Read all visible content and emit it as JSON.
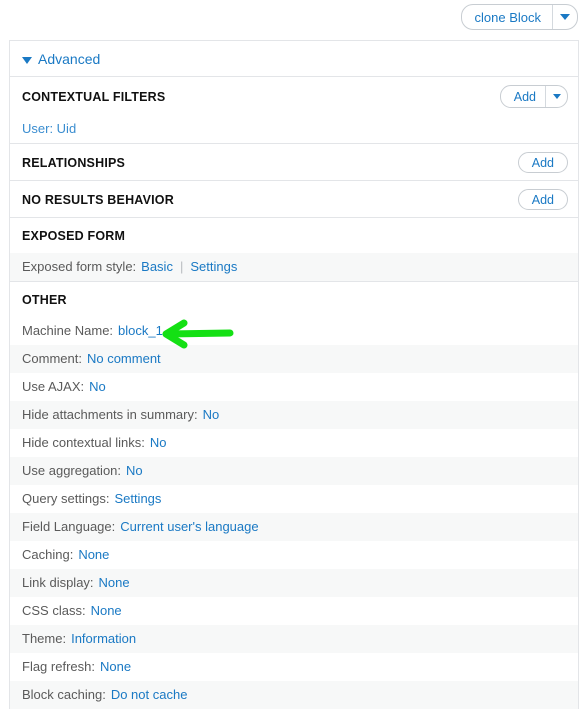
{
  "topbar": {
    "clone_button_label": "clone Block",
    "clone_button_toggle_icon": "caret-down-icon"
  },
  "advanced_panel": {
    "collapse_toggle_icon": "triangle-down-icon",
    "title": "Advanced",
    "sections": [
      {
        "title": "CONTEXTUAL FILTERS",
        "add_label": "Add",
        "has_dropdown": true,
        "rows": [
          {
            "label": "",
            "value": "User: Uid",
            "striped": false,
            "link_only": true
          }
        ]
      },
      {
        "title": "RELATIONSHIPS",
        "add_label": "Add",
        "has_dropdown": false,
        "rows": []
      },
      {
        "title": "NO RESULTS BEHAVIOR",
        "add_label": "Add",
        "has_dropdown": false,
        "rows": []
      },
      {
        "title": "EXPOSED FORM",
        "add_label": "",
        "has_dropdown": false,
        "rows": [
          {
            "label": "Exposed form style:",
            "value": "Basic",
            "separator": "|",
            "value2": "Settings",
            "striped": true
          }
        ]
      },
      {
        "title": "OTHER",
        "add_label": "",
        "has_dropdown": false,
        "rows": [
          {
            "label": "Machine Name:",
            "value": "block_1",
            "striped": false
          },
          {
            "label": "Comment:",
            "value": "No comment",
            "striped": true
          },
          {
            "label": "Use AJAX:",
            "value": "No",
            "striped": false
          },
          {
            "label": "Hide attachments in summary:",
            "value": "No",
            "striped": true
          },
          {
            "label": "Hide contextual links:",
            "value": "No",
            "striped": false
          },
          {
            "label": "Use aggregation:",
            "value": "No",
            "striped": true
          },
          {
            "label": "Query settings:",
            "value": "Settings",
            "striped": false
          },
          {
            "label": "Field Language:",
            "value": "Current user's language",
            "striped": true
          },
          {
            "label": "Caching:",
            "value": "None",
            "striped": false
          },
          {
            "label": "Link display:",
            "value": "None",
            "striped": true
          },
          {
            "label": "CSS class:",
            "value": "None",
            "striped": false
          },
          {
            "label": "Theme:",
            "value": "Information",
            "striped": true
          },
          {
            "label": "Flag refresh:",
            "value": "None",
            "striped": false
          },
          {
            "label": "Block caching:",
            "value": "Do not cache",
            "striped": true
          }
        ]
      }
    ]
  },
  "annotation": {
    "arrow_icon": "green-arrow-left-icon",
    "arrow_color": "#14e014",
    "points_at": "block_1"
  },
  "colors": {
    "link": "#1a79c4",
    "label": "#5a5a5a",
    "heading": "#111111",
    "stripe": "#f7f8f8",
    "border": "#e3e5e8"
  }
}
